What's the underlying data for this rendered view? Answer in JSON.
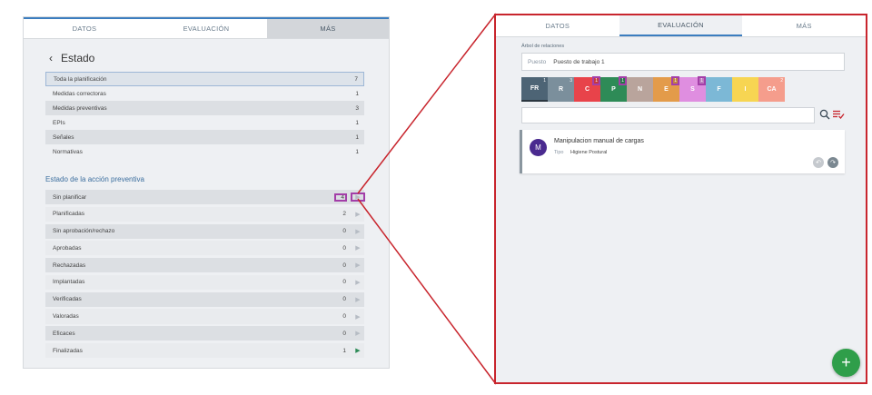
{
  "left": {
    "tabs": [
      "DATOS",
      "EVALUACIÓN",
      "MÁS"
    ],
    "back_title": "Estado",
    "summary": [
      {
        "label": "Toda la planificación",
        "count": "7"
      },
      {
        "label": "Medidas correctoras",
        "count": "1"
      },
      {
        "label": "Medidas preventivas",
        "count": "3"
      },
      {
        "label": "EPIs",
        "count": "1"
      },
      {
        "label": "Señales",
        "count": "1"
      },
      {
        "label": "Normativas",
        "count": "1"
      }
    ],
    "section_title": "Estado de la acción preventiva",
    "states": [
      {
        "label": "Sin planificar",
        "count": "4"
      },
      {
        "label": "Planificadas",
        "count": "2"
      },
      {
        "label": "Sin aprobación/rechazo",
        "count": "0"
      },
      {
        "label": "Aprobadas",
        "count": "0"
      },
      {
        "label": "Rechazadas",
        "count": "0"
      },
      {
        "label": "Implantadas",
        "count": "0"
      },
      {
        "label": "Verificadas",
        "count": "0"
      },
      {
        "label": "Valoradas",
        "count": "0"
      },
      {
        "label": "Eficaces",
        "count": "0"
      },
      {
        "label": "Finalizadas",
        "count": "1"
      }
    ]
  },
  "right": {
    "tabs": [
      "DATOS",
      "EVALUACIÓN",
      "MÁS"
    ],
    "relations_label": "Árbol de relaciones",
    "puesto_key": "Puesto",
    "puesto_value": "Puesto de trabajo 1",
    "chips": [
      {
        "label": "FR",
        "badge": "1",
        "color": "#4d6475"
      },
      {
        "label": "R",
        "badge": "3",
        "color": "#7b8f9c"
      },
      {
        "label": "C",
        "badge": "1",
        "color": "#e8434a"
      },
      {
        "label": "P",
        "badge": "1",
        "color": "#2e8b57"
      },
      {
        "label": "N",
        "badge": "",
        "color": "#b9a49c"
      },
      {
        "label": "E",
        "badge": "1",
        "color": "#e39b4a"
      },
      {
        "label": "S",
        "badge": "1",
        "color": "#df8ee0"
      },
      {
        "label": "F",
        "badge": "",
        "color": "#7cb8d6"
      },
      {
        "label": "I",
        "badge": "",
        "color": "#f7d552"
      },
      {
        "label": "CA",
        "badge": "2",
        "color": "#f59d8c"
      }
    ],
    "card": {
      "avatar": "M",
      "title": "Manipulacion manual de cargas",
      "type_key": "Tipo",
      "type_value": "Higiene Postural"
    },
    "fab": "+"
  },
  "colors": {
    "accent": "#3b7dbf",
    "highlight_frame": "#c8252d",
    "highlight_box": "#a33ea8",
    "play_active": "#2e8b57",
    "fab": "#2f9e4a"
  }
}
